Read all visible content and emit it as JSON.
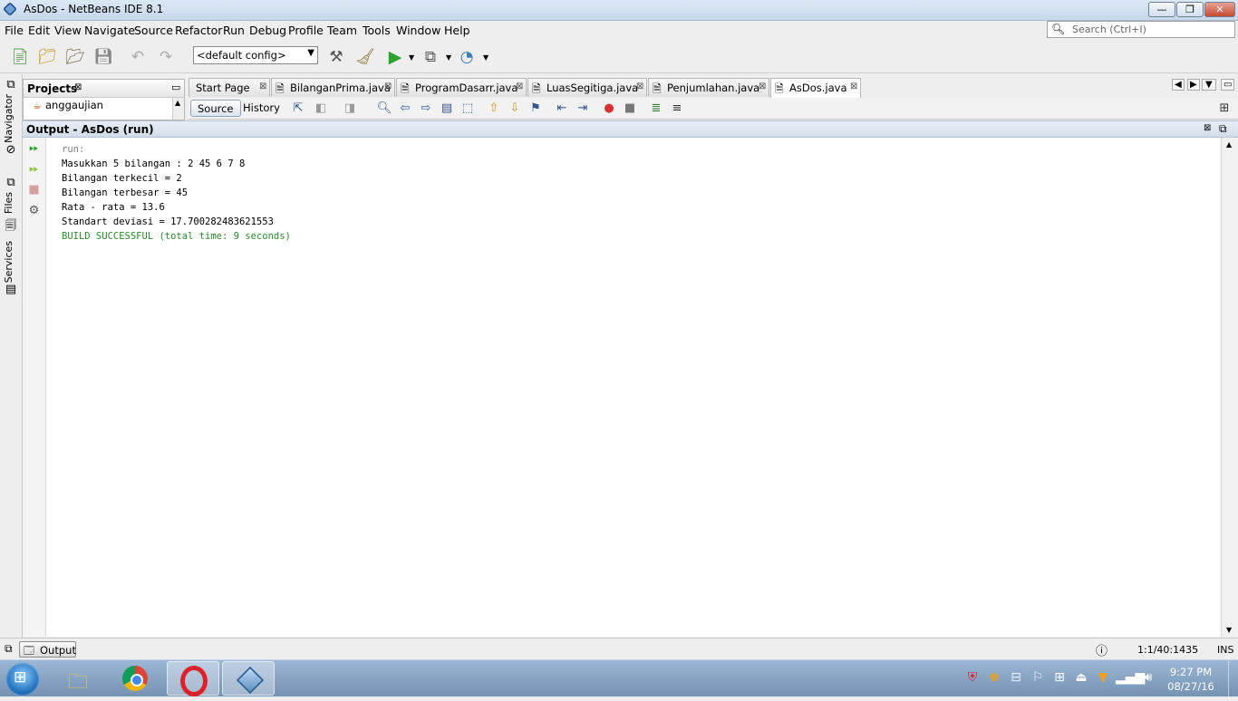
{
  "window": {
    "title": "AsDos - NetBeans IDE 8.1",
    "minimize": "—",
    "restore": "❐",
    "close": "✕"
  },
  "menubar": {
    "items": [
      "File",
      "Edit",
      "View",
      "Navigate",
      "Source",
      "Refactor",
      "Run",
      "Debug",
      "Profile",
      "Team",
      "Tools",
      "Window",
      "Help"
    ]
  },
  "search": {
    "placeholder": "Search (Ctrl+I)"
  },
  "toolbar": {
    "config_value": "<default config>"
  },
  "sidebar": {
    "tabs": [
      "Navigator",
      "Files",
      "Services"
    ]
  },
  "projects": {
    "title": "Projects",
    "items": [
      "anggaujian"
    ]
  },
  "editor_tabs": [
    {
      "label": "Start Page",
      "active": false
    },
    {
      "label": "BilanganPrima.java",
      "active": false
    },
    {
      "label": "ProgramDasarr.java",
      "active": false
    },
    {
      "label": "LuasSegitiga.java",
      "active": false
    },
    {
      "label": "Penjumlahan.java",
      "active": false
    },
    {
      "label": "AsDos.java",
      "active": true
    }
  ],
  "editor_toolbar": {
    "source_label": "Source",
    "history_label": "History"
  },
  "output": {
    "title": "Output - AsDos (run)",
    "lines": [
      {
        "text": "run:",
        "color": "#808080"
      },
      {
        "text": "Masukkan 5 bilangan : 2 45 6 7 8",
        "color": "#000000"
      },
      {
        "text": "Bilangan terkecil = 2",
        "color": "#000000"
      },
      {
        "text": "Bilangan terbesar = 45",
        "color": "#000000"
      },
      {
        "text": "Rata - rata = 13.6",
        "color": "#000000"
      },
      {
        "text": "Standart deviasi = 17.700282483621553",
        "color": "#000000"
      },
      {
        "text": "BUILD SUCCESSFUL (total time: 9 seconds)",
        "color": "#2e8b2e"
      }
    ]
  },
  "statusbar": {
    "output_tab": "Output",
    "position": "1:1/40:1435",
    "insert_mode": "INS"
  },
  "taskbar": {
    "apps": [
      "file-explorer-icon",
      "chrome-icon",
      "opera-icon",
      "netbeans-icon"
    ],
    "time": "9:27 PM",
    "date": "08/27/16"
  }
}
